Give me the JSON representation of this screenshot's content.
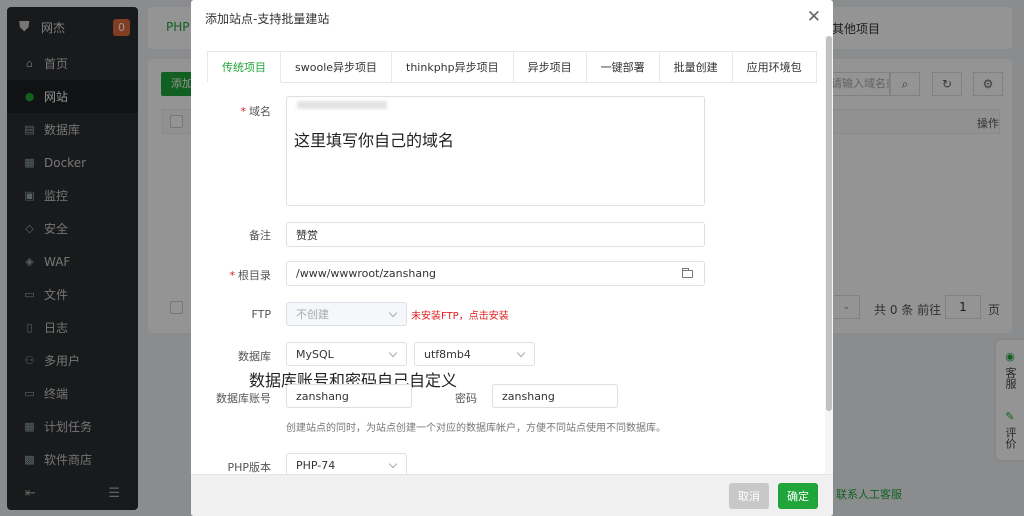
{
  "sidebar": {
    "brand": "网杰",
    "badge": "0",
    "items": [
      {
        "label": "首页",
        "icon": "home-icon",
        "glyph": "⌂",
        "active": false
      },
      {
        "label": "网站",
        "icon": "globe-icon",
        "glyph": "●",
        "active": true
      },
      {
        "label": "数据库",
        "icon": "database-icon",
        "glyph": "▤",
        "active": false
      },
      {
        "label": "Docker",
        "icon": "docker-icon",
        "glyph": "▦",
        "active": false
      },
      {
        "label": "监控",
        "icon": "monitor-icon",
        "glyph": "▣",
        "active": false
      },
      {
        "label": "安全",
        "icon": "shield-icon",
        "glyph": "◇",
        "active": false
      },
      {
        "label": "WAF",
        "icon": "waf-icon",
        "glyph": "◈",
        "active": false
      },
      {
        "label": "文件",
        "icon": "folder-icon",
        "glyph": "▭",
        "active": false
      },
      {
        "label": "日志",
        "icon": "log-icon",
        "glyph": "▯",
        "active": false
      },
      {
        "label": "多用户",
        "icon": "users-icon",
        "glyph": "⚇",
        "active": false
      },
      {
        "label": "终端",
        "icon": "terminal-icon",
        "glyph": "▭",
        "active": false
      },
      {
        "label": "计划任务",
        "icon": "calendar-icon",
        "glyph": "▦",
        "active": false
      },
      {
        "label": "软件商店",
        "icon": "store-icon",
        "glyph": "▩",
        "active": false
      }
    ]
  },
  "background": {
    "tab_php": "PHP",
    "tab_other": "其他项目",
    "add_button": "添加",
    "search_placeholder": "请输入域名或备注",
    "col_actions": "操作",
    "pager_text": "共 0 条  前往",
    "page_number": "1",
    "page_unit": "页",
    "float_service": "客服",
    "float_review": "评价",
    "bottom_link": "联系人工客服"
  },
  "modal": {
    "title": "添加站点-支持批量建站",
    "tabs": [
      {
        "label": "传统项目",
        "active": true
      },
      {
        "label": "swoole异步项目",
        "active": false
      },
      {
        "label": "thinkphp异步项目",
        "active": false
      },
      {
        "label": "异步项目",
        "active": false
      },
      {
        "label": "一键部署",
        "active": false
      },
      {
        "label": "批量创建",
        "active": false
      },
      {
        "label": "应用环境包",
        "active": false
      }
    ],
    "form": {
      "domain_label": "域名",
      "domain_annotation": "这里填写你自己的域名",
      "remark_label": "备注",
      "remark_value": "赞赏",
      "root_label": "根目录",
      "root_value": "/www/wwwroot/zanshang",
      "ftp_label": "FTP",
      "ftp_value": "不创建",
      "ftp_hint": "未安装FTP，点击安装",
      "db_label": "数据库",
      "db_type": "MySQL",
      "db_charset": "utf8mb4",
      "db_annotation": "数据库账号和密码自己自定义",
      "db_user_label": "数据库账号",
      "db_user_value": "zanshang",
      "db_pass_label": "密码",
      "db_pass_value": "zanshang",
      "db_hint": "创建站点的同时，为站点创建一个对应的数据库帐户，方便不同站点使用不同数据库。",
      "php_label": "PHP版本",
      "php_value": "PHP-74"
    },
    "cancel_label": "取消",
    "ok_label": "确定"
  },
  "colors": {
    "accent": "#20a53a",
    "danger": "#e02020",
    "sidebar_bg": "#2a2d30"
  }
}
